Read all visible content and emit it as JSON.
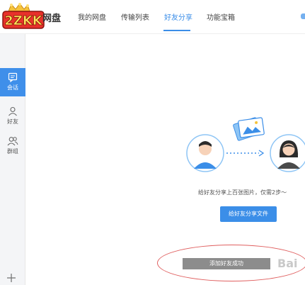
{
  "logo": {
    "text": "网盘",
    "badge": "2ZKK"
  },
  "nav": {
    "tabs": [
      {
        "label": "我的网盘"
      },
      {
        "label": "传输列表"
      },
      {
        "label": "好友分享",
        "active": true
      },
      {
        "label": "功能宝箱"
      }
    ]
  },
  "sidebar": {
    "items": [
      {
        "label": "会话",
        "icon": "chat-icon",
        "active": true
      },
      {
        "label": "好友",
        "icon": "person-icon"
      },
      {
        "label": "群组",
        "icon": "group-icon"
      }
    ],
    "add_icon": "plus-icon"
  },
  "main": {
    "caption": "给好友分享上百张图片，仅需2步～",
    "share_button": "给好友分享文件"
  },
  "toast": {
    "text": "添加好友成功"
  },
  "watermark": "Bai",
  "colors": {
    "accent": "#3b8ee8",
    "sidebar_active": "#3f8fea",
    "toast_bg": "#8c8c8c",
    "highlight_ring": "#e06060"
  }
}
